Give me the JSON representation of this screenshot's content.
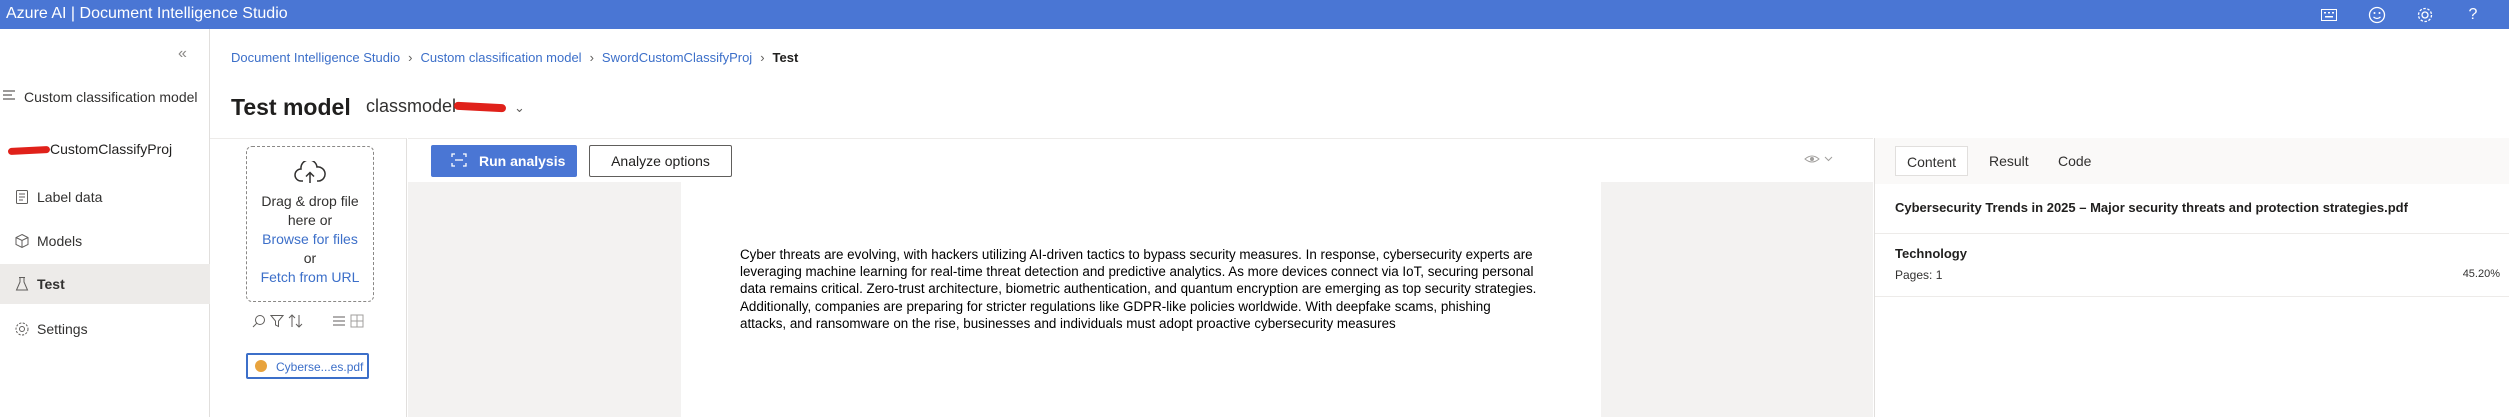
{
  "app": {
    "title": "Azure AI | Document Intelligence Studio",
    "header_icons": [
      "keyboard-icon",
      "feedback-smiley-icon",
      "settings-gear-icon",
      "help-icon"
    ]
  },
  "sidebar": {
    "collapse_glyph": "«",
    "section_label": "Custom classification model",
    "project_name": "CustomClassifyProj",
    "items": [
      {
        "label": "Label data",
        "icon": "label-data-icon"
      },
      {
        "label": "Models",
        "icon": "models-cube-icon"
      },
      {
        "label": "Test",
        "icon": "test-beaker-icon",
        "active": true
      },
      {
        "label": "Settings",
        "icon": "settings-gear-icon"
      }
    ]
  },
  "breadcrumb": {
    "items": [
      "Document Intelligence Studio",
      "Custom classification model",
      "SwordCustomClassifyProj"
    ],
    "current": "Test"
  },
  "header": {
    "page_title": "Test model",
    "model_name": "classmodel"
  },
  "upload": {
    "line1": "Drag & drop file",
    "line2": "here or",
    "browse": "Browse for files",
    "or": "or",
    "fetch": "Fetch from URL"
  },
  "file": {
    "name": "Cyberse...es.pdf"
  },
  "toolbar": {
    "run_label": "Run analysis",
    "options_label": "Analyze options"
  },
  "document": {
    "text": "Cyber threats are evolving, with hackers utilizing AI-driven tactics to bypass security measures. In response, cybersecurity experts are leveraging machine learning for real-time threat detection and predictive analytics. As more devices connect via IoT, securing personal data remains critical. Zero-trust architecture, biometric authentication, and quantum encryption are emerging as top security strategies. Additionally, companies are preparing for stricter regulations like GDPR-like policies worldwide. With deepfake scams, phishing attacks, and ransomware on the rise, businesses and individuals must adopt proactive cybersecurity measures"
  },
  "results": {
    "tabs": [
      "Content",
      "Result",
      "Code"
    ],
    "active_tab": "Content",
    "doc_name": "Cybersecurity Trends in 2025 – Major security threats and protection strategies.pdf",
    "class_name": "Technology",
    "pages": "Pages: 1",
    "confidence": "45.20%"
  }
}
